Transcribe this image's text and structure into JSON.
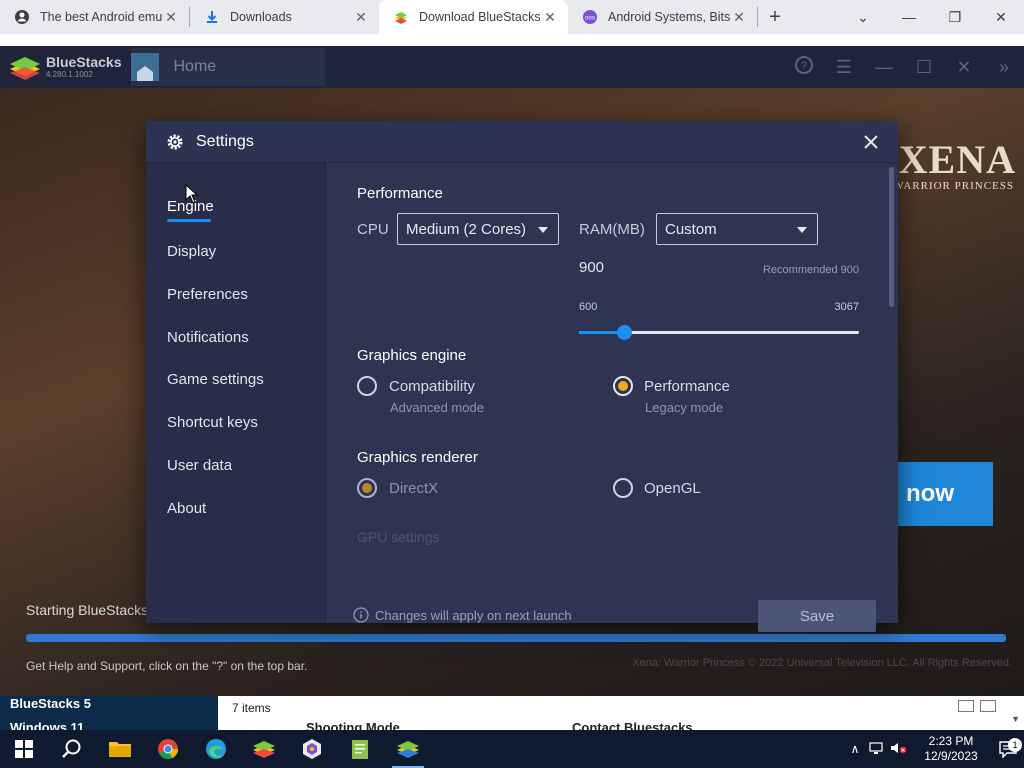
{
  "browser": {
    "tabs": [
      {
        "title": "The best Android emu",
        "active": false
      },
      {
        "title": "Downloads",
        "active": false
      },
      {
        "title": "Download BlueStacks",
        "active": true
      },
      {
        "title": "Android Systems, Bits",
        "active": false
      }
    ],
    "new_tab_symbol": "+",
    "window_controls": [
      "⌄",
      "—",
      "❐",
      "✕"
    ]
  },
  "bluestacks": {
    "app_name": "BlueStacks",
    "version": "4.280.1.1002",
    "home_tab": "Home",
    "banner_title": "XENA",
    "banner_subtitle": "WARRIOR PRINCESS",
    "play_button": "now",
    "starting_text": "Starting BlueStacks",
    "progress_percent": 100,
    "help_text": "Get Help and Support, click on the \"?\" on the top bar.",
    "copyright": "Xena: Warrior Princess © 2022 Universal Television LLC. All Rights Reserved."
  },
  "settings": {
    "title": "Settings",
    "nav": [
      {
        "label": "Engine",
        "active": true
      },
      {
        "label": "Display"
      },
      {
        "label": "Preferences"
      },
      {
        "label": "Notifications"
      },
      {
        "label": "Game settings"
      },
      {
        "label": "Shortcut keys"
      },
      {
        "label": "User data"
      },
      {
        "label": "About"
      }
    ],
    "performance": {
      "title": "Performance",
      "cpu_label": "CPU",
      "cpu_value": "Medium (2 Cores)",
      "ram_label": "RAM(MB)",
      "ram_value": "Custom",
      "ram_current": "900",
      "recommended": "Recommended 900",
      "ram_min": "600",
      "ram_max": "3067",
      "slider_fraction": 0.162
    },
    "graphics_engine": {
      "title": "Graphics engine",
      "options": [
        {
          "label": "Compatibility",
          "sub": "Advanced mode",
          "selected": false
        },
        {
          "label": "Performance",
          "sub": "Legacy mode",
          "selected": true
        }
      ]
    },
    "graphics_renderer": {
      "title": "Graphics renderer",
      "options": [
        {
          "label": "DirectX",
          "selected": true
        },
        {
          "label": "OpenGL",
          "selected": false
        }
      ]
    },
    "gpu_settings_faded": "GPU settings",
    "footer_note": "Changes will apply on next launch",
    "save_label": "Save"
  },
  "explorer": {
    "left_line1": "BlueStacks 5",
    "left_line2": "Windows 11",
    "status": "7 items",
    "behind_1": "Shooting Mode",
    "behind_2": "Contact Bluestacks"
  },
  "taskbar": {
    "time": "2:23 PM",
    "date": "12/9/2023",
    "notification_count": "1"
  },
  "colors": {
    "accent_blue": "#1c8ef0",
    "radio_selected": "#f5a623",
    "dialog_bg": "#2e3452"
  }
}
